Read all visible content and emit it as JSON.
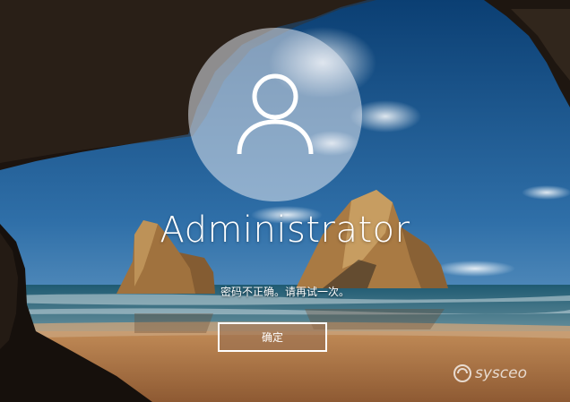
{
  "lock_screen": {
    "username": "Administrator",
    "error_message": "密码不正确。请再试一次。",
    "ok_button_label": "确定"
  },
  "avatar": {
    "icon": "user-icon"
  },
  "watermark": {
    "text": "sysceo"
  },
  "colors": {
    "sky_top": "#0b3f73",
    "sky_bottom": "#5e9ac6",
    "sea": "#2c6c80",
    "sand": "#b37a48",
    "cave": "#1c140f",
    "text": "#ffffff"
  }
}
